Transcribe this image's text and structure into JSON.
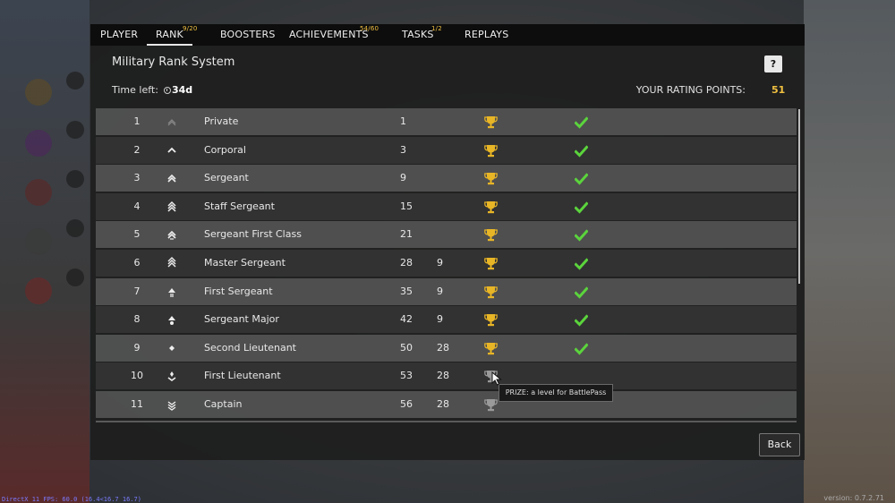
{
  "tabs": [
    {
      "label": "PLAYER",
      "badge": ""
    },
    {
      "label": "RANK",
      "badge": "9/20"
    },
    {
      "label": "BOOSTERS",
      "badge": ""
    },
    {
      "label": "ACHIEVEMENTS",
      "badge": "54/60"
    },
    {
      "label": "TASKS",
      "badge": "1/2"
    },
    {
      "label": "REPLAYS",
      "badge": ""
    }
  ],
  "active_tab": "RANK",
  "panel": {
    "title": "Military Rank System",
    "help_label": "?",
    "time_left_label": "Time left:",
    "time_left_value": "34d",
    "rating_label": "YOUR RATING POINTS:",
    "rating_value": "51"
  },
  "ranks": [
    {
      "num": "1",
      "name": "Private",
      "points": "1",
      "req": "",
      "prize": "gold",
      "done": true
    },
    {
      "num": "2",
      "name": "Corporal",
      "points": "3",
      "req": "",
      "prize": "gold",
      "done": true
    },
    {
      "num": "3",
      "name": "Sergeant",
      "points": "9",
      "req": "",
      "prize": "gold",
      "done": true
    },
    {
      "num": "4",
      "name": "Staff Sergeant",
      "points": "15",
      "req": "",
      "prize": "gold",
      "done": true
    },
    {
      "num": "5",
      "name": "Sergeant First Class",
      "points": "21",
      "req": "",
      "prize": "gold",
      "done": true
    },
    {
      "num": "6",
      "name": "Master Sergeant",
      "points": "28",
      "req": "9",
      "prize": "gold",
      "done": true
    },
    {
      "num": "7",
      "name": "First Sergeant",
      "points": "35",
      "req": "9",
      "prize": "gold",
      "done": true
    },
    {
      "num": "8",
      "name": "Sergeant Major",
      "points": "42",
      "req": "9",
      "prize": "gold",
      "done": true
    },
    {
      "num": "9",
      "name": "Second Lieutenant",
      "points": "50",
      "req": "28",
      "prize": "gold",
      "done": true
    },
    {
      "num": "10",
      "name": "First Lieutenant",
      "points": "53",
      "req": "28",
      "prize": "grey",
      "done": false
    },
    {
      "num": "11",
      "name": "Captain",
      "points": "56",
      "req": "28",
      "prize": "grey",
      "done": false
    }
  ],
  "tooltip": "PRIZE: a level for BattlePass",
  "back_label": "Back",
  "fps_text": "DirectX 11 FPS: 60.0 (16.4<16.7 16.7)",
  "version_text": "version: 0.7.2.71",
  "colors": {
    "accent": "#f0c040",
    "check": "#5bd43c",
    "trophy": "#e8b526",
    "trophy_grey": "#9a9a9a"
  }
}
